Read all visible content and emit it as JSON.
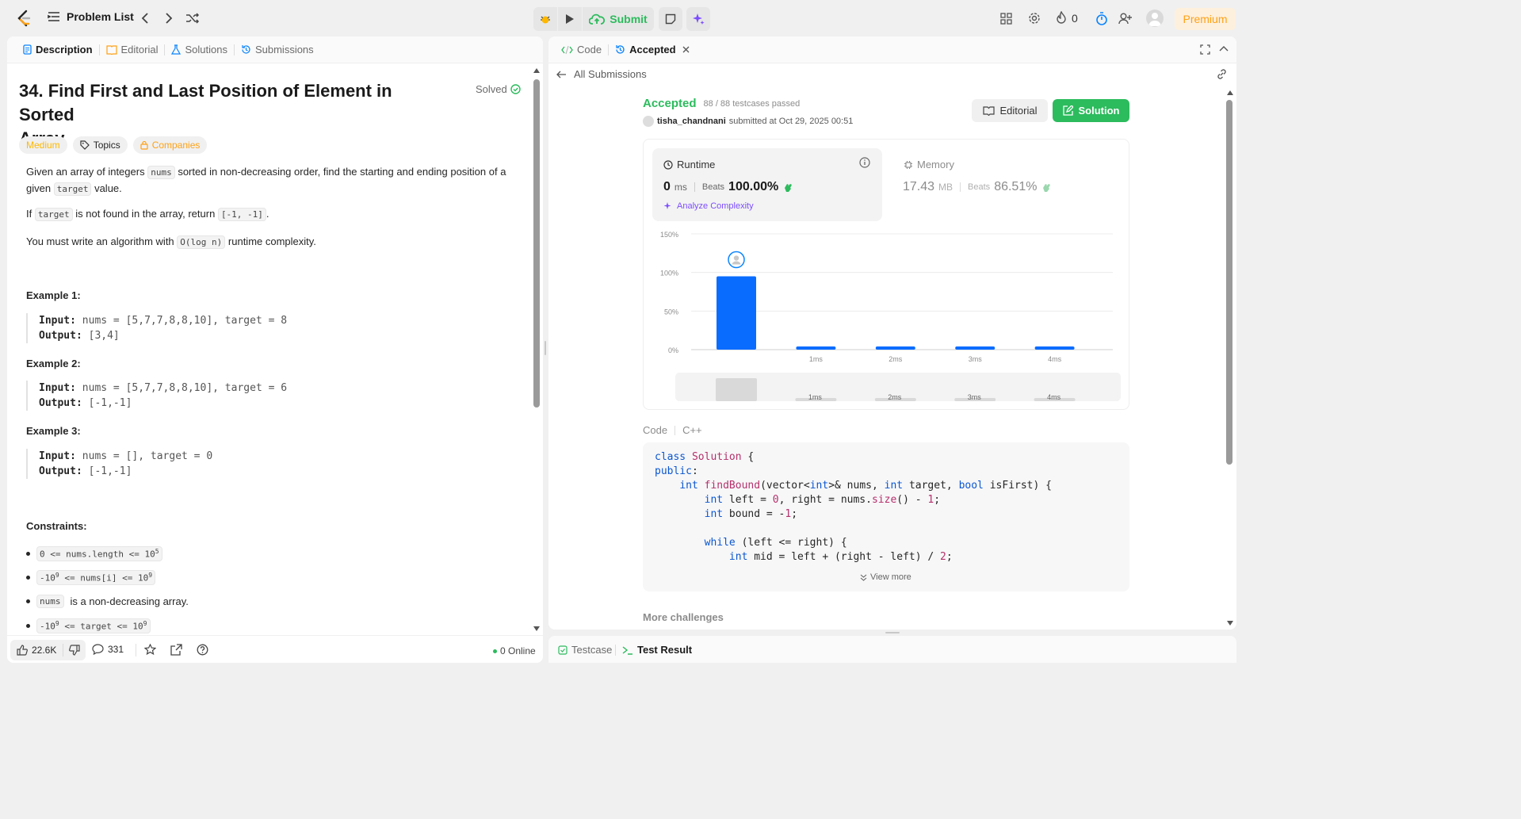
{
  "header": {
    "problem_list_label": "Problem List",
    "submit_label": "Submit",
    "streak_count": "0",
    "premium_label": "Premium"
  },
  "left_tabs": [
    {
      "label": "Description"
    },
    {
      "label": "Editorial"
    },
    {
      "label": "Solutions"
    },
    {
      "label": "Submissions"
    }
  ],
  "problem": {
    "title_line1": "34. Find First and Last Position of Element in Sorted",
    "title_line2": "Array",
    "status": "Solved",
    "difficulty": "Medium",
    "topics_label": "Topics",
    "companies_label": "Companies",
    "desc1_a": "Given an array of integers",
    "desc1_code1": "nums",
    "desc1_b": "sorted in non-decreasing order, find the starting and ending position of a",
    "desc1_c": "given",
    "desc1_code2": "target",
    "desc1_d": "value.",
    "desc2_a": "If",
    "desc2_code1": "target",
    "desc2_b": "is not found in the array, return",
    "desc2_code2": "[-1, -1]",
    "desc2_c": ".",
    "desc3_a": "You must write an algorithm with",
    "desc3_code": "O(log n)",
    "desc3_b": "runtime complexity.",
    "examples": [
      {
        "heading": "Example 1:",
        "input_label": "Input:",
        "input": "nums = [5,7,7,8,8,10], target = 8",
        "output_label": "Output:",
        "output": "[3,4]"
      },
      {
        "heading": "Example 2:",
        "input_label": "Input:",
        "input": "nums = [5,7,7,8,8,10], target = 6",
        "output_label": "Output:",
        "output": "[-1,-1]"
      },
      {
        "heading": "Example 3:",
        "input_label": "Input:",
        "input": "nums = [], target = 0",
        "output_label": "Output:",
        "output": "[-1,-1]"
      }
    ],
    "constraints_heading": "Constraints:",
    "constraint1_a": "0 <= nums.length <= 10",
    "constraint1_sup": "5",
    "constraint2_a": "-10",
    "constraint2_sup1": "9",
    "constraint2_b": " <= nums[i] <= 10",
    "constraint2_sup2": "9",
    "constraint3_code": "nums",
    "constraint3_text": "is a non-decreasing array.",
    "constraint4_a": "-10",
    "constraint4_sup1": "9",
    "constraint4_b": " <= target <= 10",
    "constraint4_sup2": "9"
  },
  "left_footer": {
    "likes": "22.6K",
    "comments": "331",
    "online": "0 Online"
  },
  "right_tabs": {
    "code_label": "Code",
    "accepted_label": "Accepted",
    "all_submissions_label": "All Submissions"
  },
  "submission": {
    "status": "Accepted",
    "testcases": "88 / 88 testcases passed",
    "username": "tisha_chandnani",
    "submitted_text": "submitted at Oct 29, 2025 00:51",
    "editorial_label": "Editorial",
    "solution_label": "Solution",
    "runtime_label": "Runtime",
    "runtime_value": "0",
    "runtime_unit": "ms",
    "beats_label": "Beats",
    "runtime_beats": "100.00%",
    "analyze_label": "Analyze Complexity",
    "memory_label": "Memory",
    "memory_value": "17.43",
    "memory_unit": "MB",
    "memory_beats": "86.51%"
  },
  "chart_data": {
    "type": "bar",
    "y_ticks": [
      "150%",
      "100%",
      "50%",
      "0%"
    ],
    "categories": [
      "",
      "1ms",
      "2ms",
      "3ms",
      "4ms"
    ],
    "values": [
      95,
      3,
      3,
      3,
      3
    ],
    "ylim": [
      0,
      150
    ],
    "grid": true,
    "highlight_index": 0
  },
  "code_section": {
    "label": "Code",
    "language": "C++",
    "view_more": "View more",
    "more_challenges": "More challenges"
  },
  "bottom_tabs": {
    "testcase_label": "Testcase",
    "test_result_label": "Test Result"
  },
  "colors": {
    "accent_green": "#2cbb5d",
    "bar_blue": "#0a6cff",
    "medium_orange": "#ffb800"
  }
}
